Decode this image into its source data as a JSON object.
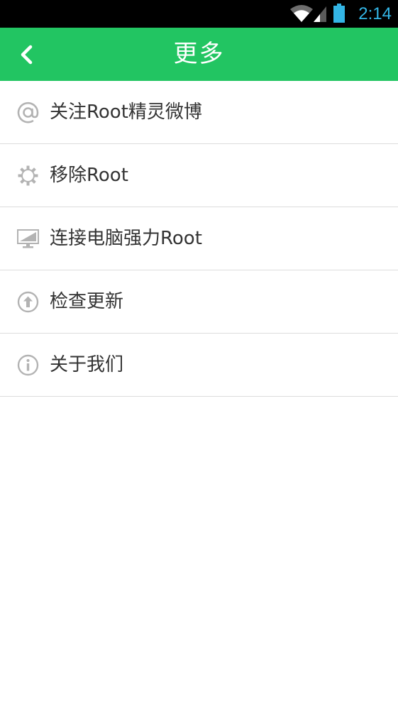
{
  "status_bar": {
    "time": "2:14",
    "icons": [
      "wifi-icon",
      "signal-icon",
      "battery-icon"
    ],
    "clock_color": "#33b5e5"
  },
  "header": {
    "title": "更多",
    "back_icon": "chevron-left-icon",
    "background_color": "#22c562"
  },
  "menu": {
    "items": [
      {
        "label": "关注Root精灵微博",
        "icon": "at-sign-icon"
      },
      {
        "label": "移除Root",
        "icon": "gear-icon"
      },
      {
        "label": "连接电脑强力Root",
        "icon": "monitor-icon"
      },
      {
        "label": "检查更新",
        "icon": "upload-arrow-icon"
      },
      {
        "label": "关于我们",
        "icon": "info-icon"
      }
    ]
  }
}
